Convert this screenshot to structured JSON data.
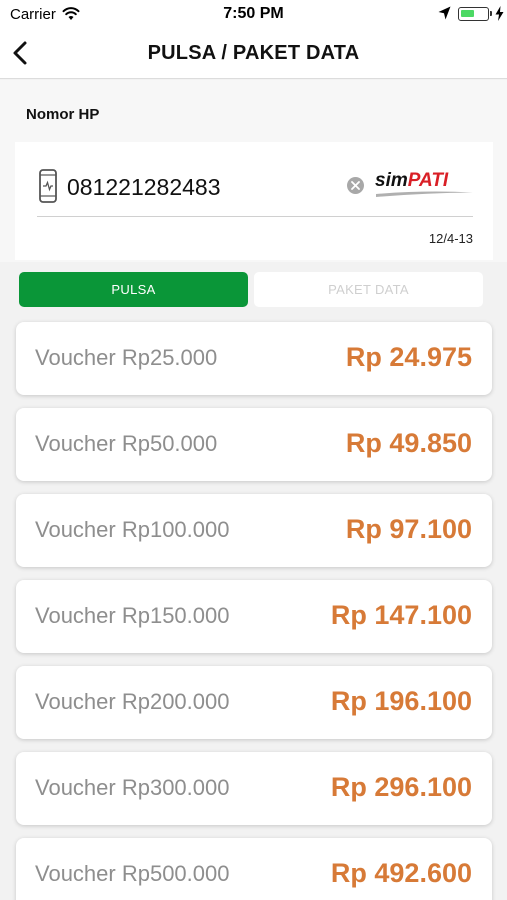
{
  "status_bar": {
    "carrier": "Carrier",
    "time": "7:50 PM",
    "battery_level": 0.5,
    "icons": [
      "wifi-icon",
      "location-icon",
      "battery-icon",
      "charging-icon"
    ]
  },
  "header": {
    "title": "PULSA / PAKET DATA",
    "back_icon": "chevron-left-icon"
  },
  "phone": {
    "label": "Nomor HP",
    "number": "081221282483",
    "phone_icon": "phone-icon",
    "clear_icon": "clear-icon",
    "operator_logo": {
      "prefix": "sim",
      "suffix": "PATI"
    },
    "meta": "12/4-13"
  },
  "tabs": [
    {
      "label": "PULSA",
      "active": true
    },
    {
      "label": "PAKET DATA",
      "active": false
    }
  ],
  "vouchers": [
    {
      "name": "Voucher Rp25.000",
      "price": "Rp 24.975"
    },
    {
      "name": "Voucher Rp50.000",
      "price": "Rp 49.850"
    },
    {
      "name": "Voucher Rp100.000",
      "price": "Rp 97.100"
    },
    {
      "name": "Voucher Rp150.000",
      "price": "Rp 147.100"
    },
    {
      "name": "Voucher Rp200.000",
      "price": "Rp 196.100"
    },
    {
      "name": "Voucher Rp300.000",
      "price": "Rp 296.100"
    },
    {
      "name": "Voucher Rp500.000",
      "price": "Rp 492.600"
    }
  ],
  "colors": {
    "accent_green": "#0a9638",
    "price_orange": "#d77a37",
    "voucher_text_gray": "#8e8e8e",
    "operator_red": "#d91f26"
  }
}
